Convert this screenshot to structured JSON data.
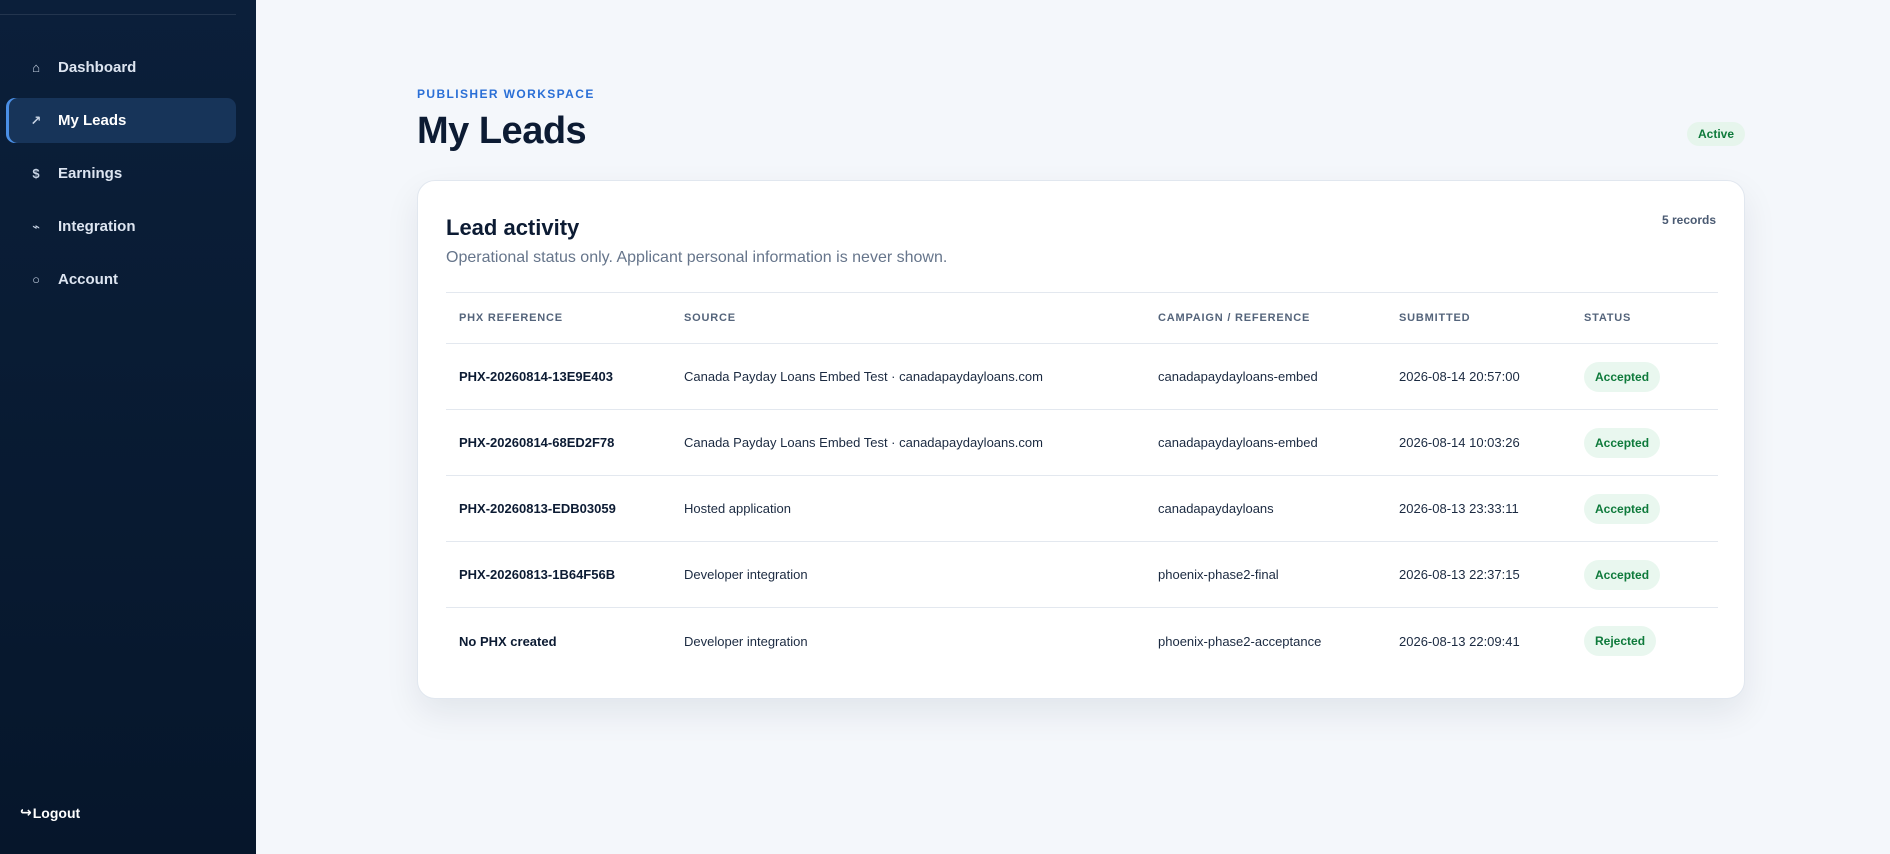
{
  "sidebar": {
    "items": [
      {
        "label": "Dashboard",
        "icon": "home-icon",
        "glyph": "⌂",
        "active": false
      },
      {
        "label": "My Leads",
        "icon": "trend-arrow-icon",
        "glyph": "↗",
        "active": true
      },
      {
        "label": "Earnings",
        "icon": "dollar-icon",
        "glyph": "$",
        "active": false
      },
      {
        "label": "Integration",
        "icon": "link-icon",
        "glyph": "⌁",
        "active": false
      },
      {
        "label": "Account",
        "icon": "user-circle-icon",
        "glyph": "○",
        "active": false
      }
    ],
    "logout_label": "Logout",
    "logout_glyph": "↪"
  },
  "header": {
    "eyebrow": "PUBLISHER WORKSPACE",
    "title": "My Leads",
    "status_badge": "Active"
  },
  "card": {
    "title": "Lead activity",
    "subtitle": "Operational status only. Applicant personal information is never shown.",
    "record_count": "5 records",
    "columns": [
      "PHX REFERENCE",
      "SOURCE",
      "CAMPAIGN / REFERENCE",
      "SUBMITTED",
      "STATUS"
    ],
    "rows": [
      {
        "ref": "PHX-20260814-13E9E403",
        "source": "Canada Payday Loans Embed Test · canadapaydayloans.com",
        "campaign": "canadapaydayloans-embed",
        "submitted": "2026-08-14 20:57:00",
        "status": "Accepted"
      },
      {
        "ref": "PHX-20260814-68ED2F78",
        "source": "Canada Payday Loans Embed Test · canadapaydayloans.com",
        "campaign": "canadapaydayloans-embed",
        "submitted": "2026-08-14 10:03:26",
        "status": "Accepted"
      },
      {
        "ref": "PHX-20260813-EDB03059",
        "source": "Hosted application",
        "campaign": "canadapaydayloans",
        "submitted": "2026-08-13 23:33:11",
        "status": "Accepted"
      },
      {
        "ref": "PHX-20260813-1B64F56B",
        "source": "Developer integration",
        "campaign": "phoenix-phase2-final",
        "submitted": "2026-08-13 22:37:15",
        "status": "Accepted"
      },
      {
        "ref": "No PHX created",
        "source": "Developer integration",
        "campaign": "phoenix-phase2-acceptance",
        "submitted": "2026-08-13 22:09:41",
        "status": "Rejected"
      }
    ]
  },
  "colors": {
    "sidebar_bg": "#0b1f3a",
    "accent": "#2a6fd6",
    "status_green": "#0e7a3b",
    "status_green_bg": "#e9f7ef"
  }
}
